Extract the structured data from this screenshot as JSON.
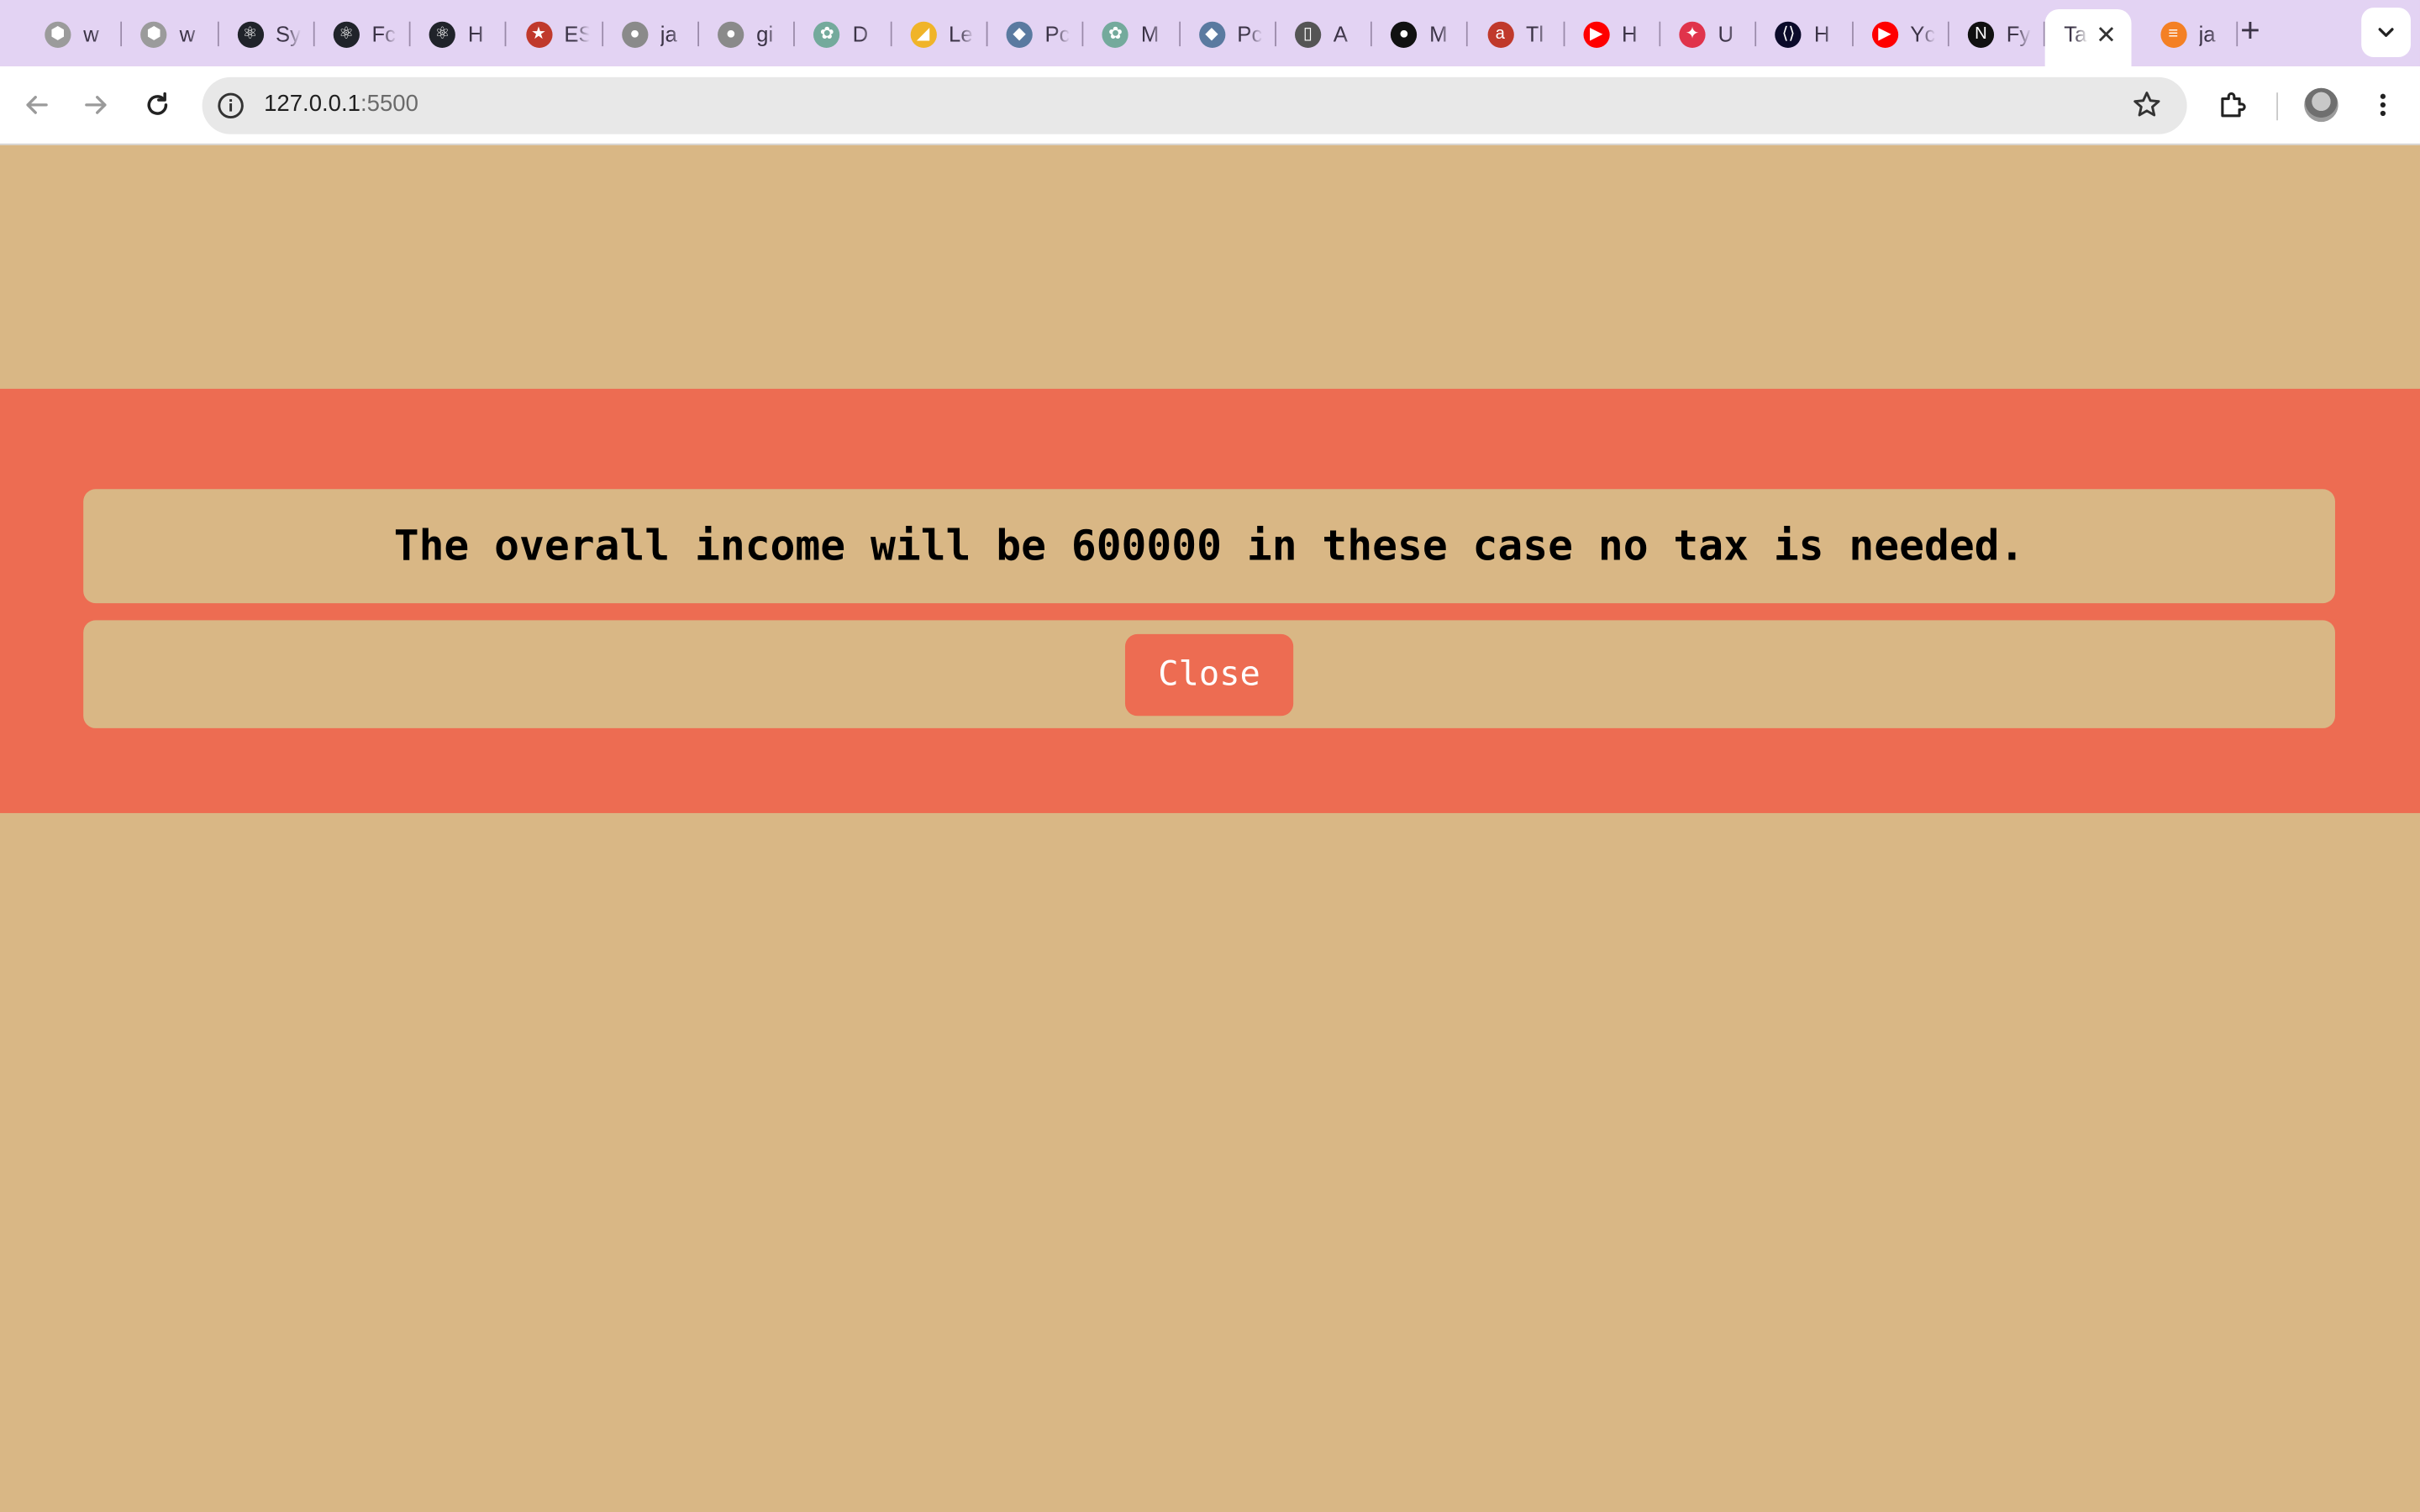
{
  "browser": {
    "tabs": [
      {
        "title": "w",
        "icon": "grey-shield-icon",
        "color": "#9b9b9b"
      },
      {
        "title": "w",
        "icon": "grey-shield-icon",
        "color": "#9b9b9b"
      },
      {
        "title": "Sy",
        "icon": "react-icon",
        "color": "#20232a"
      },
      {
        "title": "Fc",
        "icon": "react-icon",
        "color": "#20232a"
      },
      {
        "title": "H",
        "icon": "react-icon",
        "color": "#20232a"
      },
      {
        "title": "ES",
        "icon": "star-badge-icon",
        "color": "#c0392b"
      },
      {
        "title": "ja",
        "icon": "github-icon",
        "color": "#8a8a8a"
      },
      {
        "title": "gi",
        "icon": "github-icon",
        "color": "#8a8a8a"
      },
      {
        "title": "D",
        "icon": "chatgpt-icon",
        "color": "#74aa9c"
      },
      {
        "title": "Le",
        "icon": "leetcode-icon",
        "color": "#f0b429"
      },
      {
        "title": "Pc",
        "icon": "postgres-icon",
        "color": "#5a7aa0"
      },
      {
        "title": "M",
        "icon": "chatgpt-icon",
        "color": "#74aa9c"
      },
      {
        "title": "Pc",
        "icon": "postgres-icon",
        "color": "#5a7aa0"
      },
      {
        "title": "A",
        "icon": "document-icon",
        "color": "#555555"
      },
      {
        "title": "M",
        "icon": "github-icon",
        "color": "#111111"
      },
      {
        "title": "Tl",
        "icon": "a-letter-icon",
        "color": "#c0392b"
      },
      {
        "title": "H",
        "icon": "youtube-icon",
        "color": "#ff0000"
      },
      {
        "title": "U",
        "icon": "udemy-icon",
        "color": "#e0334b"
      },
      {
        "title": "H",
        "icon": "code-icon",
        "color": "#0b0b2a"
      },
      {
        "title": "Yc",
        "icon": "youtube-icon",
        "color": "#ff0000"
      },
      {
        "title": "Fy",
        "icon": "notion-icon",
        "color": "#111111"
      },
      {
        "title": "Ta",
        "icon": "none",
        "color": "#ffffff",
        "active": true
      },
      {
        "title": "ja",
        "icon": "stack-icon",
        "color": "#f48024"
      }
    ],
    "address": {
      "host": "127.0.0.1",
      "port": ":5500"
    }
  },
  "page": {
    "message": "The overall income will be 600000 in these case no tax is needed.",
    "close_label": "Close",
    "colors": {
      "background": "#d9b785",
      "accent": "#ed6c52"
    }
  }
}
